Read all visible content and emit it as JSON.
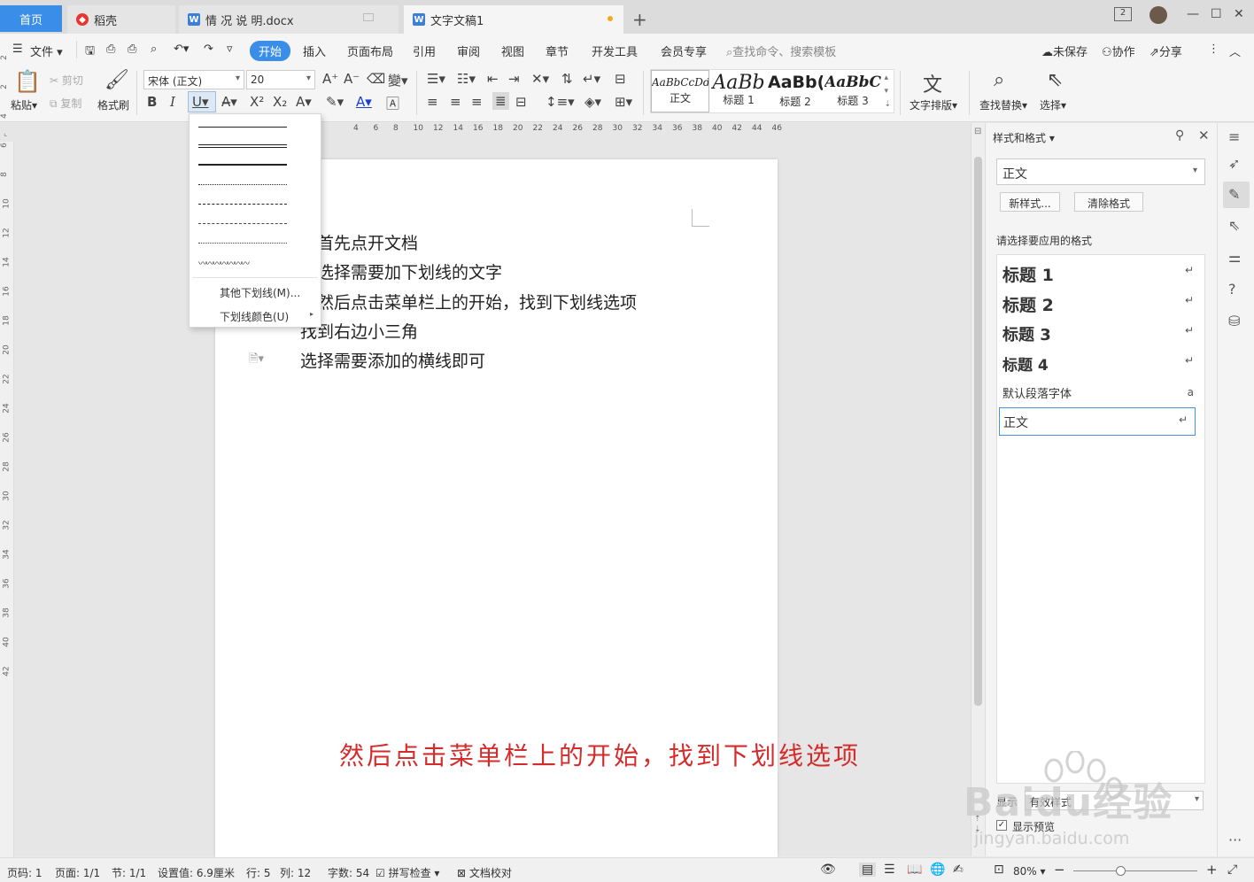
{
  "tabs": {
    "home": "首页",
    "t1": "稻壳",
    "t2": "情 况 说 明.docx",
    "t3": "文字文稿1",
    "window_badge": "2"
  },
  "menu": {
    "file": "文件",
    "start": "开始",
    "insert": "插入",
    "layout": "页面布局",
    "ref": "引用",
    "review": "审阅",
    "view": "视图",
    "chapter": "章节",
    "dev": "开发工具",
    "vip": "会员专享",
    "search": "查找命令、搜索模板",
    "unsaved": "未保存",
    "collab": "协作",
    "share": "分享"
  },
  "ribbon": {
    "paste": "粘贴",
    "cut": "剪切",
    "copy": "复制",
    "format_painter": "格式刷",
    "font": "宋体 (正文)",
    "size": "20",
    "text_layout": "文字排版",
    "find_replace": "查找替换",
    "select": "选择",
    "styles": [
      {
        "sample": "AaBbCcDd",
        "name": "正文"
      },
      {
        "sample": "AaBb",
        "name": "标题 1"
      },
      {
        "sample": "AaBb(",
        "name": "标题 2"
      },
      {
        "sample": "AaBbC",
        "name": "标题 3"
      }
    ]
  },
  "dropdown": {
    "more_underline": "其他下划线(M)...",
    "underline_color": "下划线颜色(U)"
  },
  "ruler": {
    "h": [
      "4",
      "6",
      "8",
      "10",
      "12",
      "14",
      "16",
      "18",
      "20",
      "22",
      "24",
      "26",
      "28",
      "30",
      "32",
      "34",
      "36",
      "38",
      "40",
      "42",
      "44",
      "46"
    ],
    "v": [
      "2",
      "2",
      "4",
      "6",
      "8",
      "10",
      "12",
      "14",
      "16",
      "18",
      "20",
      "22",
      "24",
      "26",
      "28",
      "30",
      "32",
      "34",
      "36",
      "38",
      "40",
      "42"
    ]
  },
  "doc": {
    "lines": [
      "首先点开文档",
      "选择需要加下划线的文字",
      "然后点击菜单栏上的开始，找到下划线选项",
      "找到右边小三角",
      "选择需要添加的横线即可"
    ],
    "caption": "然后点击菜单栏上的开始，找到下划线选项"
  },
  "panel": {
    "title": "样式和格式",
    "current": "正文",
    "new_style": "新样式...",
    "clear": "清除格式",
    "hint": "请选择要应用的格式",
    "items": [
      {
        "label": "标题  1"
      },
      {
        "label": "标题  2"
      },
      {
        "label": "标题  3"
      },
      {
        "label": "标题  4"
      },
      {
        "label": "默认段落字体"
      },
      {
        "label": "正文"
      }
    ],
    "show": "显示",
    "show_val": "有效样式",
    "preview": "显示预览"
  },
  "status": {
    "page_code": "页码: 1",
    "page": "页面: 1/1",
    "section": "节: 1/1",
    "setting": "设置值: 6.9厘米",
    "row": "行: 5",
    "col": "列: 12",
    "words": "字数: 54",
    "spell": "拼写检查",
    "proof": "文档校对",
    "zoom": "80%"
  },
  "watermark": {
    "brand": "Baidu经验",
    "url": "jingyan.baidu.com"
  },
  "colors": {
    "accent": "#3b8ee8",
    "caption": "#d42b2b"
  }
}
